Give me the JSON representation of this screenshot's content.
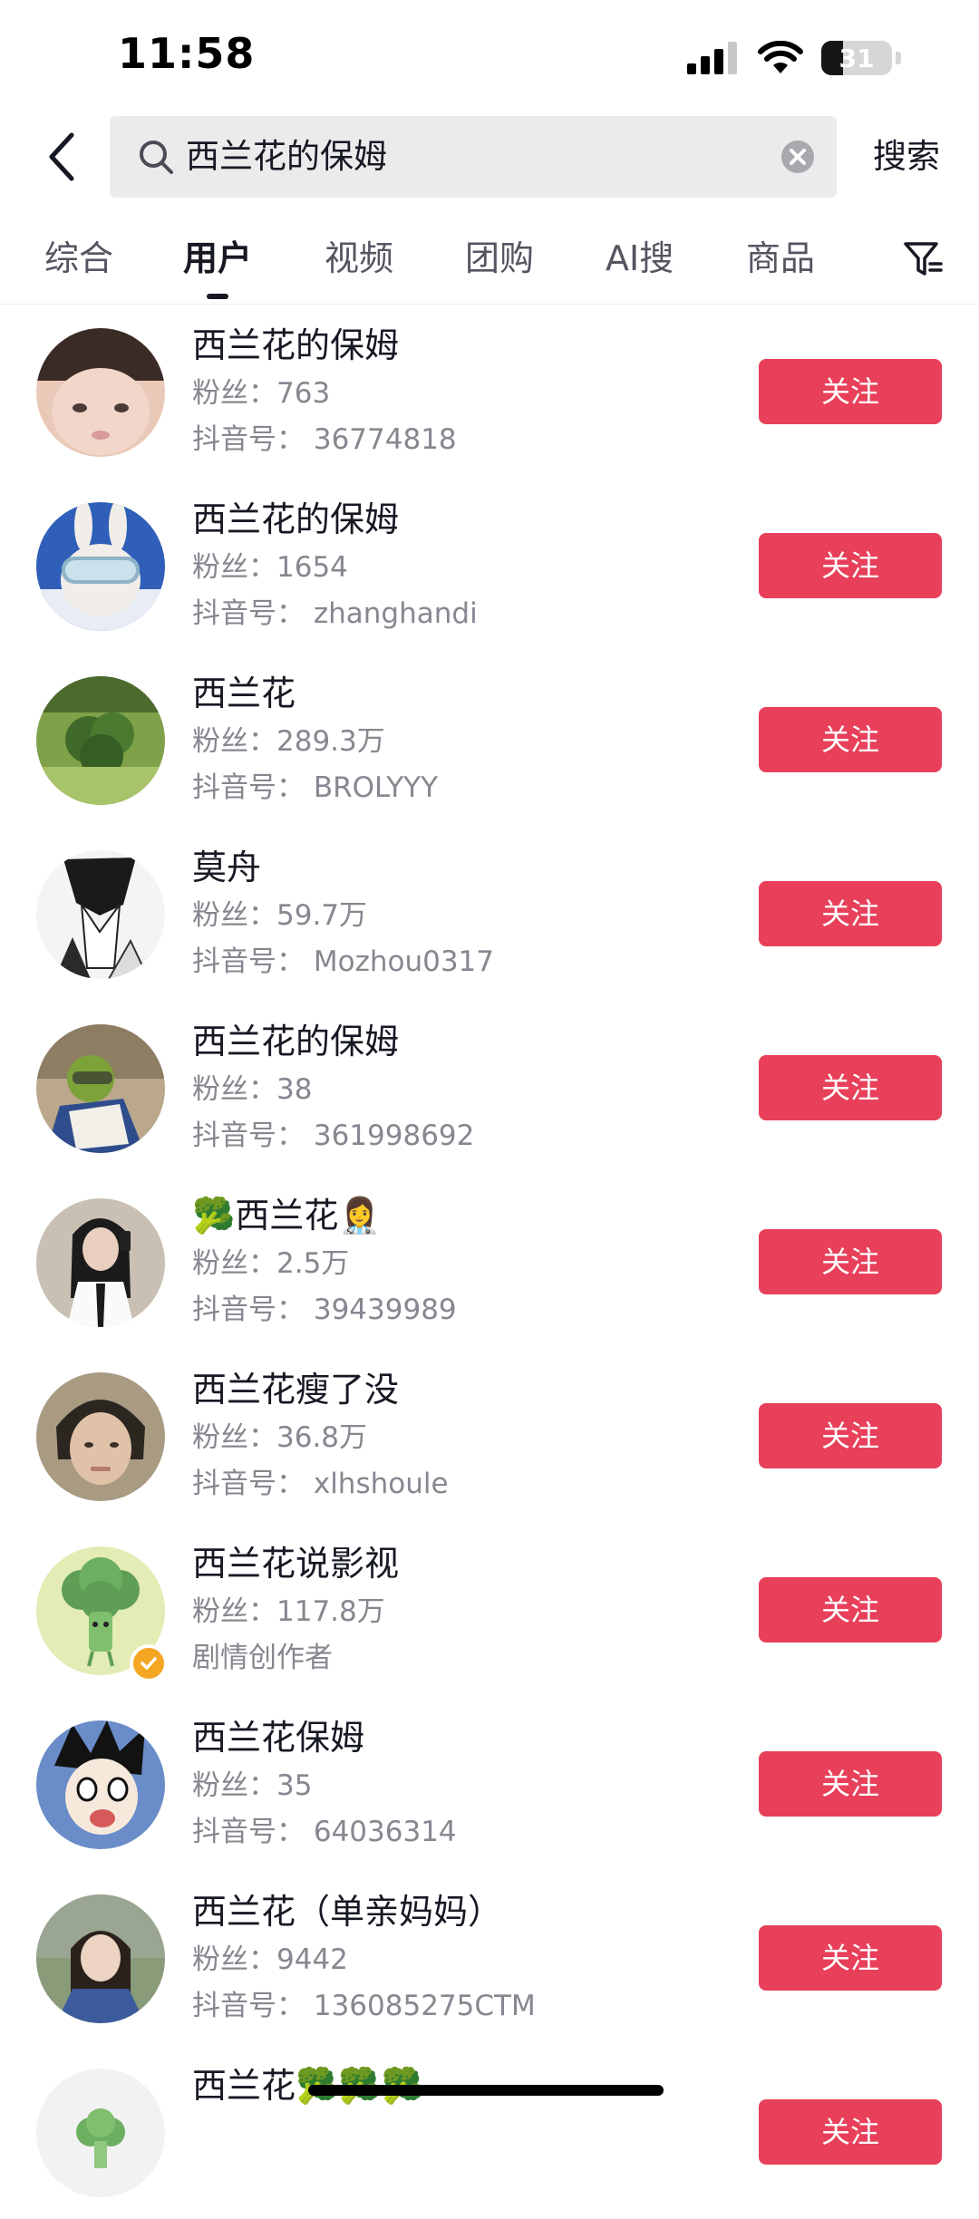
{
  "status": {
    "time": "11:58",
    "battery": "31",
    "battery_level": 0.31
  },
  "search": {
    "query": "西兰花的保姆",
    "submit_label": "搜索"
  },
  "tabs": [
    {
      "label": "综合"
    },
    {
      "label": "用户",
      "active": true
    },
    {
      "label": "视频"
    },
    {
      "label": "团购"
    },
    {
      "label": "AI搜"
    },
    {
      "label": "商品"
    }
  ],
  "users": [
    {
      "name": "西兰花的保姆",
      "fans": "粉丝：763",
      "id": "抖音号：  36774818",
      "follow": "关注",
      "avatar": "child-face"
    },
    {
      "name": "西兰花的保姆",
      "fans": "粉丝：1654",
      "id": "抖音号：  zhanghandi",
      "follow": "关注",
      "avatar": "rabbit-goggles"
    },
    {
      "name": "西兰花",
      "fans": "粉丝：289.3万",
      "id": "抖音号：  BROLYYY",
      "follow": "关注",
      "avatar": "broccoli-photo"
    },
    {
      "name": "莫舟",
      "fans": "粉丝：59.7万",
      "id": "抖音号：  Mozhou0317",
      "follow": "关注",
      "avatar": "anime-sketch"
    },
    {
      "name": "西兰花的保姆",
      "fans": "粉丝：38",
      "id": "抖音号：  361998692",
      "follow": "关注",
      "avatar": "broccoli-book"
    },
    {
      "name": "🥦西兰花👩‍⚕️",
      "fans": "粉丝：2.5万",
      "id": "抖音号：  39439989",
      "follow": "关注",
      "avatar": "mirror-selfie"
    },
    {
      "name": "西兰花瘦了没",
      "fans": "粉丝：36.8万",
      "id": "抖音号：  xlhshoule",
      "follow": "关注",
      "avatar": "woman-face"
    },
    {
      "name": "西兰花说影视",
      "fans": "粉丝：117.8万",
      "id": "剧情创作者",
      "follow": "关注",
      "avatar": "broccoli-cartoon",
      "verified": true
    },
    {
      "name": "西兰花保姆",
      "fans": "粉丝：35",
      "id": "抖音号：  64036314",
      "follow": "关注",
      "avatar": "anime-shocked"
    },
    {
      "name": "西兰花（单亲妈妈）",
      "fans": "粉丝：9442",
      "id": "抖音号：  136085275CTM",
      "follow": "关注",
      "avatar": "woman-outdoor"
    },
    {
      "name": "西兰花🥦🥦🥦",
      "fans": "",
      "id": "",
      "follow": "关注",
      "avatar": "broccoli-partial"
    }
  ],
  "colors": {
    "accent": "#e8405a",
    "secondary_text": "#86878f",
    "search_bg": "#ebebeb",
    "verified": "#f5a623"
  }
}
